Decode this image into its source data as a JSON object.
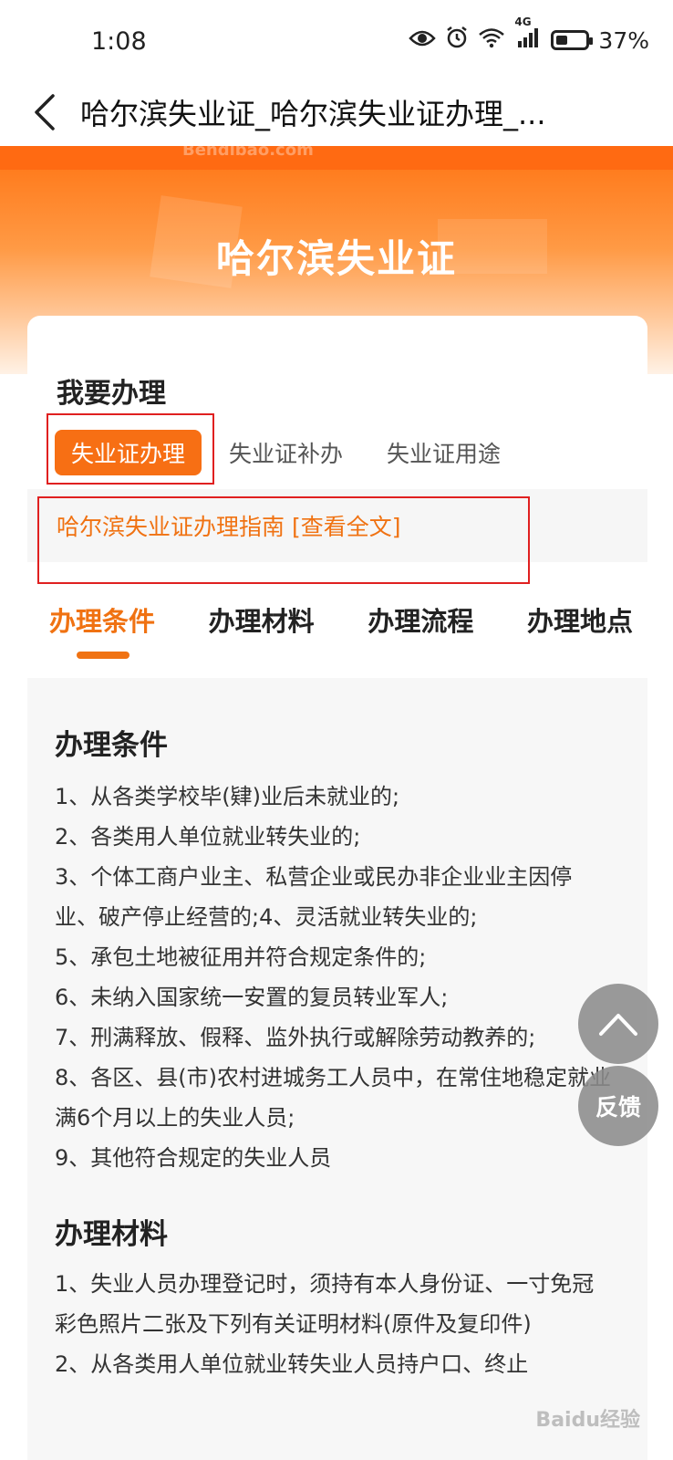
{
  "status_bar": {
    "time": "1:08",
    "network": "4G",
    "battery": "37%"
  },
  "app_bar": {
    "title": "哈尔滨失业证_哈尔滨失业证办理_..."
  },
  "banner": {
    "watermark": "Bendibao.com",
    "title": "哈尔滨失业证"
  },
  "section": {
    "label": "我要办理",
    "pills": [
      "失业证办理",
      "失业证补办",
      "失业证用途"
    ],
    "guide_link": "哈尔滨失业证办理指南 [查看全文]"
  },
  "subtabs": [
    "办理条件",
    "办理材料",
    "办理流程",
    "办理地点"
  ],
  "content": {
    "conditions_title": "办理条件",
    "conditions": [
      "1、从各类学校毕(肄)业后未就业的;",
      "2、各类用人单位就业转失业的;",
      "3、个体工商户业主、私营企业或民办非企业业主因停业、破产停止经营的;4、灵活就业转失业的;",
      "5、承包土地被征用并符合规定条件的;",
      "6、未纳入国家统一安置的复员转业军人;",
      "7、刑满释放、假释、监外执行或解除劳动教养的;",
      "8、各区、县(市)农村进城务工人员中，在常住地稳定就业满6个月以上的失业人员;",
      "9、其他符合规定的失业人员"
    ],
    "materials_title": "办理材料",
    "materials": [
      "1、失业人员办理登记时，须持有本人身份证、一寸免冠彩色照片二张及下列有关证明材料(原件及复印件)",
      "2、从各类用人单位就业转失业人员持户口、终止"
    ]
  },
  "floating": {
    "feedback": "反馈"
  },
  "watermark": "Baidu经验",
  "colors": {
    "accent": "#f07212",
    "highlight_box": "#e02020"
  }
}
